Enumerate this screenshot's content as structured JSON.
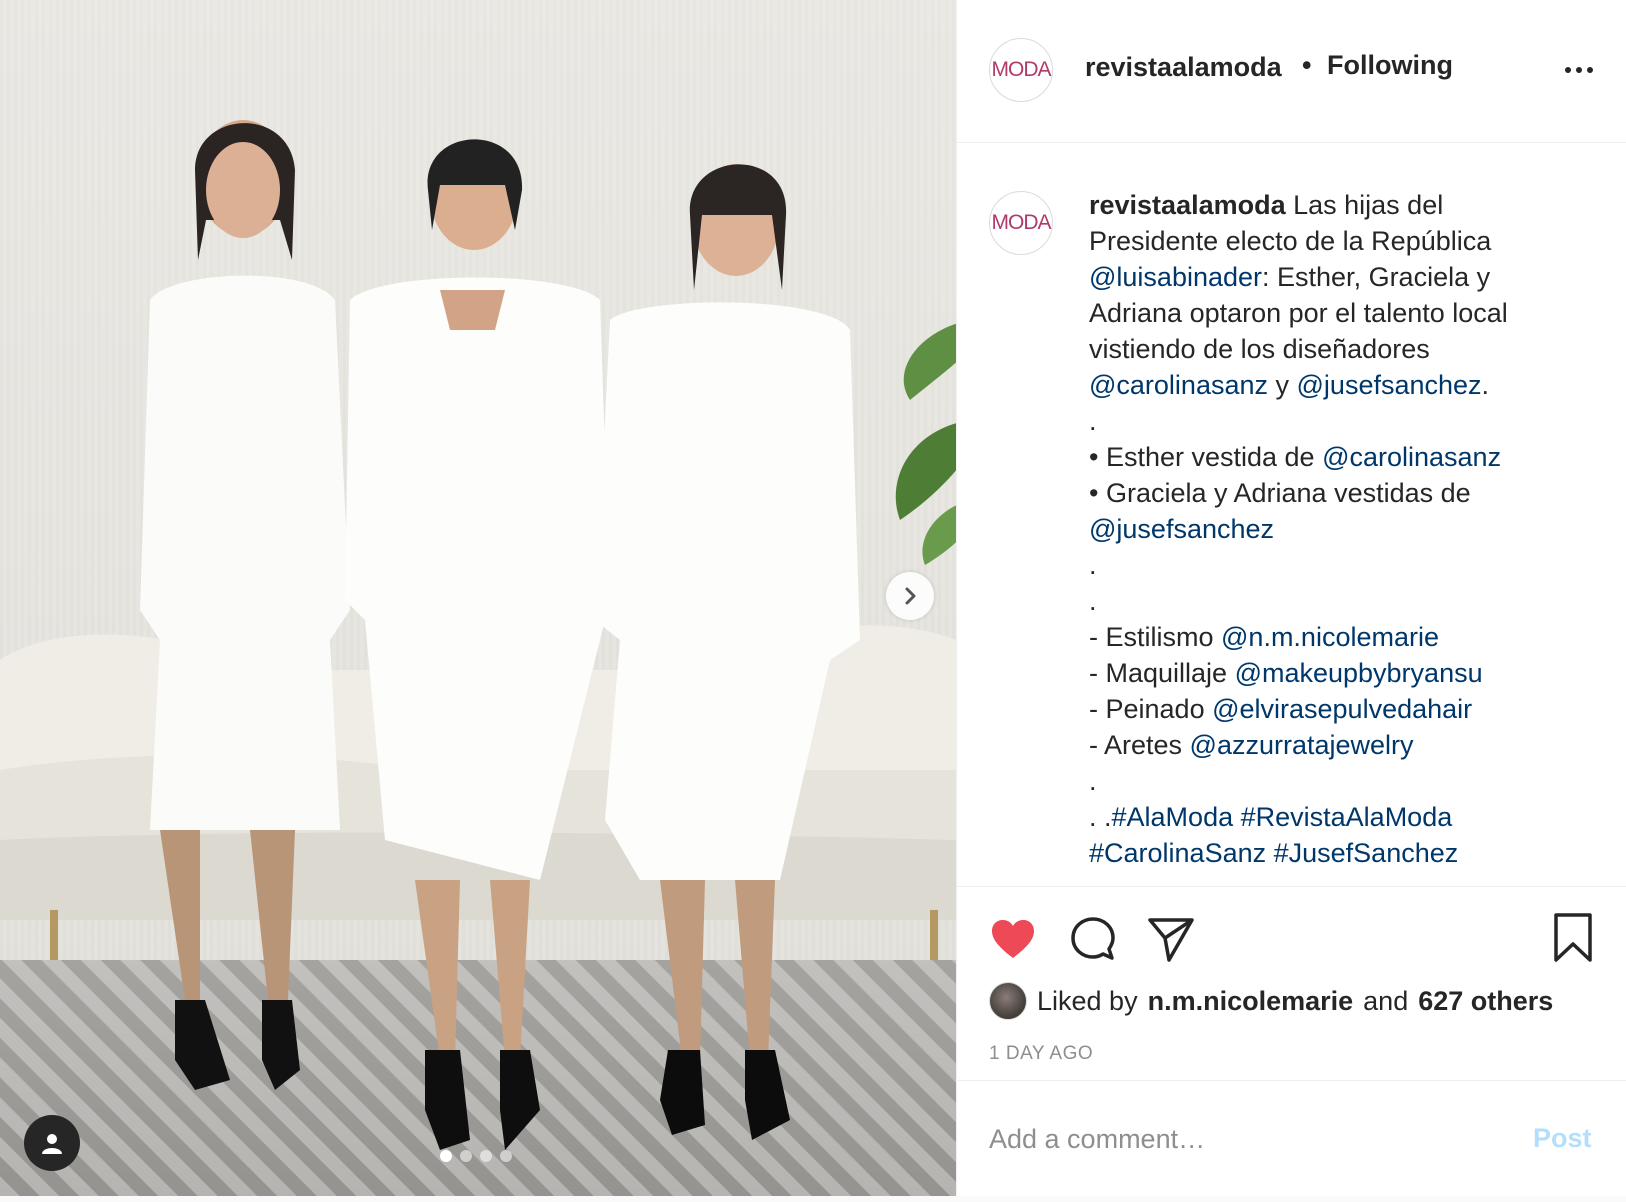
{
  "post": {
    "username": "revistaalamoda",
    "avatar_logo_text": "MODA",
    "follow_separator": "•",
    "follow_status": "Following",
    "more_icon": "more-horizontal-icon"
  },
  "media": {
    "carousel_total": 4,
    "carousel_active_index": 0,
    "next_icon": "chevron-right-icon",
    "tag_icon": "user-tag-icon"
  },
  "caption": {
    "username": "revistaalamoda",
    "segments": [
      {
        "text": " Las hijas del Presidente electo de la República ",
        "link": false
      },
      {
        "text": "@luisabinader",
        "link": true
      },
      {
        "text": ": Esther, Graciela y Adriana optaron por el talento local vistiendo de los diseñadores ",
        "link": false
      },
      {
        "text": "@carolinasanz",
        "link": true
      },
      {
        "text": " y ",
        "link": false
      },
      {
        "text": "@jusefsanchez",
        "link": true
      },
      {
        "text": ".\n.\n• Esther vestida de ",
        "link": false
      },
      {
        "text": "@carolinasanz",
        "link": true
      },
      {
        "text": "\n• Graciela y Adriana vestidas de ",
        "link": false
      },
      {
        "text": "@jusefsanchez",
        "link": true
      },
      {
        "text": "\n.\n.\n- Estilismo ",
        "link": false
      },
      {
        "text": "@n.m.nicolemarie",
        "link": true
      },
      {
        "text": "\n- Maquillaje ",
        "link": false
      },
      {
        "text": "@makeupbybryansu",
        "link": true
      },
      {
        "text": "\n- Peinado ",
        "link": false
      },
      {
        "text": "@elvirasepulvedahair",
        "link": true
      },
      {
        "text": "\n- Aretes ",
        "link": false
      },
      {
        "text": "@azzurratajewelry",
        "link": true
      },
      {
        "text": "\n.\n. .",
        "link": false
      },
      {
        "text": "#AlaModa",
        "link": true
      },
      {
        "text": " ",
        "link": false
      },
      {
        "text": "#RevistaAlaModa",
        "link": true
      },
      {
        "text": "\n",
        "link": false
      },
      {
        "text": "#CarolinaSanz",
        "link": true
      },
      {
        "text": " ",
        "link": false
      },
      {
        "text": "#JusefSanchez",
        "link": true
      }
    ]
  },
  "actions": {
    "like_icon": "heart-filled-icon",
    "comment_icon": "comment-icon",
    "share_icon": "share-icon",
    "save_icon": "bookmark-icon",
    "liked_by_prefix": "Liked by",
    "liked_by_user": "n.m.nicolemarie",
    "liked_by_and": "and",
    "liked_by_others": "627 others",
    "timestamp": "1 DAY AGO"
  },
  "comment": {
    "placeholder": "Add a comment…",
    "post_label": "Post"
  },
  "colors": {
    "like_red": "#ed4956",
    "link_blue": "#00376b",
    "post_disabled": "#b2dffc",
    "brand_logo": "#b03a6b"
  }
}
